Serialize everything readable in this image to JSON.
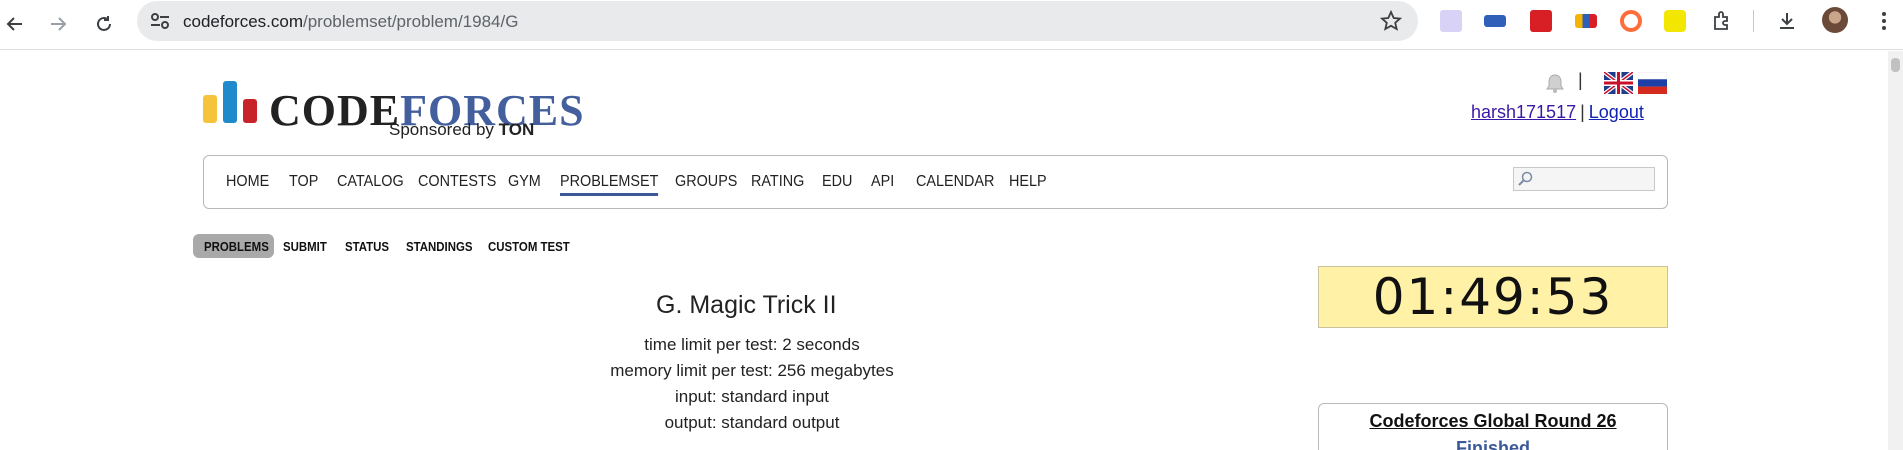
{
  "browser": {
    "url_host": "codeforces.com",
    "url_path": "/problemset/problem/1984/G",
    "icons": [
      "back-icon",
      "forward-icon",
      "reload-icon",
      "site-info-icon",
      "star-icon",
      "extensions-icon",
      "download-icon",
      "kebab-menu-icon"
    ]
  },
  "header": {
    "logo_code": "CODE",
    "logo_forces": "FORCES",
    "sponsored_prefix": "Sponsored by",
    "sponsor": "TON",
    "separator": "|",
    "username": "harsh171517",
    "user_separator": "|",
    "logout": "Logout"
  },
  "menu": {
    "items": [
      "HOME",
      "TOP",
      "CATALOG",
      "CONTESTS",
      "GYM",
      "PROBLEMSET",
      "GROUPS",
      "RATING",
      "EDU",
      "API",
      "CALENDAR",
      "HELP"
    ],
    "active": "PROBLEMSET"
  },
  "subnav": {
    "items": [
      "PROBLEMS",
      "SUBMIT",
      "STATUS",
      "STANDINGS",
      "CUSTOM TEST"
    ],
    "active": "PROBLEMS"
  },
  "problem": {
    "title": "G. Magic Trick II",
    "time_limit": "time limit per test: 2 seconds",
    "memory_limit": "memory limit per test: 256 megabytes",
    "input": "input: standard input",
    "output": "output: standard output"
  },
  "sidebar": {
    "timer": "01:49:53",
    "round_title": "Codeforces Global Round 26",
    "round_status": "Finished"
  },
  "colors": {
    "accent": "#3b5998",
    "timer_bg": "#fff1a6",
    "link_visited": "#3b17a6"
  }
}
